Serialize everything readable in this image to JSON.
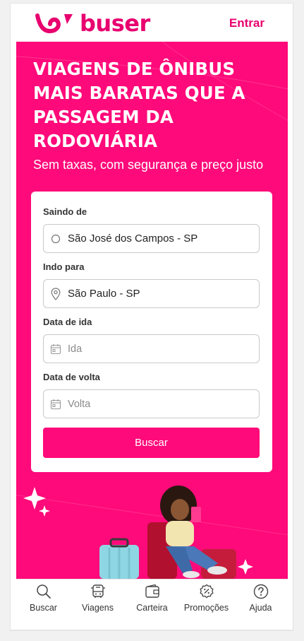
{
  "header": {
    "brand": "buser",
    "login_label": "Entrar",
    "brand_color": "#e8006f"
  },
  "hero": {
    "headline": "VIAGENS DE ÔNIBUS MAIS BARATAS QUE A PASSAGEM DA RODOVIÁRIA",
    "subtitle": "Sem taxas, com segurança e preço justo",
    "background_color": "#ff0a7a"
  },
  "search_form": {
    "origin": {
      "label": "Saindo de",
      "value": "São José dos Campos - SP",
      "icon": "radio-circle-icon"
    },
    "destination": {
      "label": "Indo para",
      "value": "São Paulo - SP",
      "icon": "map-pin-icon"
    },
    "departure_date": {
      "label": "Data de ida",
      "placeholder": "Ida",
      "icon": "calendar-icon"
    },
    "return_date": {
      "label": "Data de volta",
      "placeholder": "Volta",
      "icon": "calendar-icon"
    },
    "submit_label": "Buscar"
  },
  "bottom_nav": {
    "items": [
      {
        "label": "Buscar",
        "icon": "search-icon"
      },
      {
        "label": "Viagens",
        "icon": "bus-icon"
      },
      {
        "label": "Carteira",
        "icon": "wallet-icon"
      },
      {
        "label": "Promoções",
        "icon": "discount-badge-icon"
      },
      {
        "label": "Ajuda",
        "icon": "help-icon"
      }
    ]
  }
}
